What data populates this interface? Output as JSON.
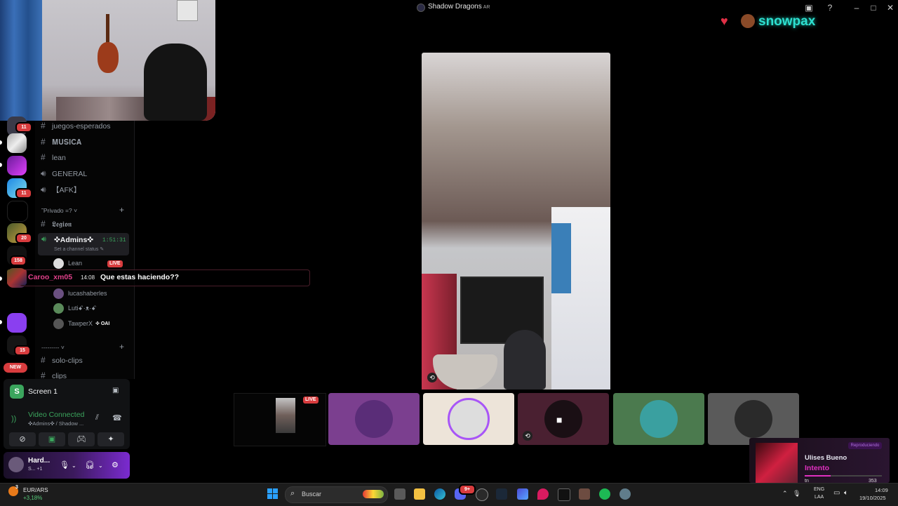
{
  "window": {
    "title": "Shadow Dragons",
    "title_suffix": "AR",
    "icons": [
      "inbox-icon",
      "help-icon",
      "minimize-icon",
      "maximize-icon",
      "close-icon"
    ]
  },
  "servers": {
    "badges": [
      "11",
      "11",
      "20",
      "158",
      "15"
    ],
    "new_label": "NEW"
  },
  "channels": {
    "items": [
      "juegos-esperados",
      "𝐌𝐔𝐒𝐈𝐂𝐀",
      "lean",
      "GENERAL",
      "【AFK】"
    ],
    "category_private": "˜Privado =? ˅",
    "legion": "𝕷𝖊𝖌𝖎𝖔𝖓",
    "voice_channel": {
      "name": "✜Admins✜",
      "timer": "1:51:31",
      "status_placeholder": "Set a channel status ✎"
    },
    "members": [
      {
        "name": "Lean",
        "tag": "LIVE"
      },
      {
        "name": "lucashaberles",
        "tag": ""
      },
      {
        "name": "Lutiꗃ·ᴥ·ꗃ",
        "tag": ""
      },
      {
        "name": "TawperX",
        "tag": "✜ OAI"
      }
    ],
    "category_dashes": "--------- ˅",
    "bottom_items": [
      "solo-clips",
      "clips"
    ]
  },
  "chat_overlay": {
    "username": "Caroo_xm05",
    "time": "14:08",
    "message": "Que estas haciendo??"
  },
  "voice_panel": {
    "screen_label": "Screen 1",
    "status": "Video Connected",
    "location": "✜Admins✜ / Shadow ..."
  },
  "user_panel": {
    "name": "Hard...",
    "status": "S...",
    "extra": "+1"
  },
  "stream": {
    "live_label": "LIVE"
  },
  "overlay_brand": {
    "name": "snowpax"
  },
  "music": {
    "badge": "Reproduciendo",
    "artist": "Ulises Bueno",
    "song": "Intento",
    "left_text": "tn",
    "right_text": "353",
    "progress": 0.34
  },
  "taskbar": {
    "weather_badge": "3",
    "ticker": "EUR/ARS",
    "change": "+3,18%",
    "search_placeholder": "Buscar",
    "lang_line1": "ENG",
    "lang_line2": "LAA",
    "time": "14:09",
    "date": "19/10/2025",
    "notification_count": "9+"
  },
  "colors": {
    "accent": "#5865f2",
    "live": "#d83c3e",
    "connected": "#3ba55d",
    "brand": "#2ee0d0"
  }
}
